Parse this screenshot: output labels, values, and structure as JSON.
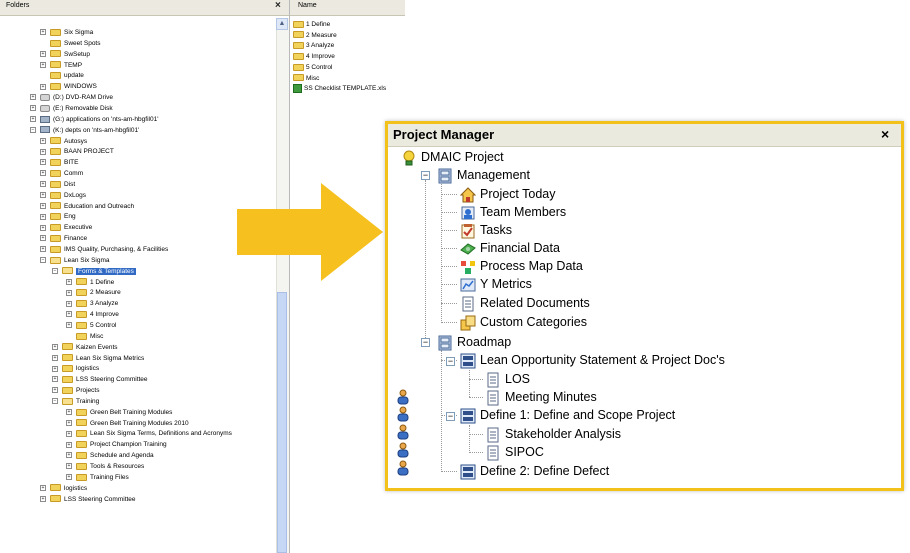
{
  "explorer": {
    "folders_title": "Folders",
    "close_glyph": "×",
    "name_column": "Name",
    "tree": [
      {
        "label": "Six Sigma",
        "level": 2,
        "exp": "+",
        "icon": "folder"
      },
      {
        "label": "Sweet Spots",
        "level": 2,
        "exp": "",
        "icon": "folder"
      },
      {
        "label": "SwSetup",
        "level": 2,
        "exp": "+",
        "icon": "folder"
      },
      {
        "label": "TEMP",
        "level": 2,
        "exp": "+",
        "icon": "folder"
      },
      {
        "label": "update",
        "level": 2,
        "exp": "",
        "icon": "folder"
      },
      {
        "label": "WINDOWS",
        "level": 2,
        "exp": "+",
        "icon": "folder"
      },
      {
        "label": "(D:) DVD-RAM Drive",
        "level": 1,
        "exp": "+",
        "icon": "drive"
      },
      {
        "label": "(E:) Removable Disk",
        "level": 1,
        "exp": "+",
        "icon": "drive"
      },
      {
        "label": "(G:) applications on 'nts-am-hbgfil01'",
        "level": 1,
        "exp": "+",
        "icon": "net"
      },
      {
        "label": "(K:) depts on 'nts-am-hbgfil01'",
        "level": 1,
        "exp": "−",
        "icon": "net"
      },
      {
        "label": "Autosys",
        "level": 2,
        "exp": "+",
        "icon": "folder"
      },
      {
        "label": "BAAN PROJECT",
        "level": 2,
        "exp": "+",
        "icon": "folder"
      },
      {
        "label": "BITE",
        "level": 2,
        "exp": "+",
        "icon": "folder"
      },
      {
        "label": "Comm",
        "level": 2,
        "exp": "+",
        "icon": "folder"
      },
      {
        "label": "Dist",
        "level": 2,
        "exp": "+",
        "icon": "folder"
      },
      {
        "label": "DxLogs",
        "level": 2,
        "exp": "+",
        "icon": "folder"
      },
      {
        "label": "Education and Outreach",
        "level": 2,
        "exp": "+",
        "icon": "folder"
      },
      {
        "label": "Eng",
        "level": 2,
        "exp": "+",
        "icon": "folder"
      },
      {
        "label": "Executive",
        "level": 2,
        "exp": "+",
        "icon": "folder"
      },
      {
        "label": "Finance",
        "level": 2,
        "exp": "+",
        "icon": "folder"
      },
      {
        "label": "IMS Quality, Purchasing, & Facilities",
        "level": 2,
        "exp": "+",
        "icon": "folder"
      },
      {
        "label": "Lean Six Sigma",
        "level": 2,
        "exp": "−",
        "icon": "folder-open"
      },
      {
        "label": "Forms & Templates",
        "level": 3,
        "exp": "−",
        "icon": "folder-open",
        "selected": true
      },
      {
        "label": "1 Define",
        "level": 4,
        "exp": "+",
        "icon": "folder"
      },
      {
        "label": "2 Measure",
        "level": 4,
        "exp": "+",
        "icon": "folder"
      },
      {
        "label": "3 Analyze",
        "level": 4,
        "exp": "+",
        "icon": "folder"
      },
      {
        "label": "4 Improve",
        "level": 4,
        "exp": "+",
        "icon": "folder"
      },
      {
        "label": "5 Control",
        "level": 4,
        "exp": "+",
        "icon": "folder"
      },
      {
        "label": "Misc",
        "level": 4,
        "exp": "",
        "icon": "folder"
      },
      {
        "label": "Kaizen Events",
        "level": 3,
        "exp": "+",
        "icon": "folder"
      },
      {
        "label": "Lean Six Sigma Metrics",
        "level": 3,
        "exp": "+",
        "icon": "folder"
      },
      {
        "label": "logistics",
        "level": 3,
        "exp": "+",
        "icon": "folder"
      },
      {
        "label": "LSS Steering Committee",
        "level": 3,
        "exp": "+",
        "icon": "folder"
      },
      {
        "label": "Projects",
        "level": 3,
        "exp": "+",
        "icon": "folder"
      },
      {
        "label": "Training",
        "level": 3,
        "exp": "−",
        "icon": "folder-open"
      },
      {
        "label": "Green Belt Training Modules",
        "level": 4,
        "exp": "+",
        "icon": "folder"
      },
      {
        "label": "Green Belt Training Modules 2010",
        "level": 4,
        "exp": "+",
        "icon": "folder"
      },
      {
        "label": "Lean Six Sigma Terms, Definitions and Acronyms",
        "level": 4,
        "exp": "+",
        "icon": "folder"
      },
      {
        "label": "Project Champion Training",
        "level": 4,
        "exp": "+",
        "icon": "folder"
      },
      {
        "label": "Schedule and Agenda",
        "level": 4,
        "exp": "+",
        "icon": "folder"
      },
      {
        "label": "Tools & Resources",
        "level": 4,
        "exp": "+",
        "icon": "folder"
      },
      {
        "label": "Training Files",
        "level": 4,
        "exp": "+",
        "icon": "folder"
      },
      {
        "label": "logistics",
        "level": 2,
        "exp": "+",
        "icon": "folder"
      },
      {
        "label": "LSS Steering Committee",
        "level": 2,
        "exp": "+",
        "icon": "folder"
      }
    ],
    "files": [
      {
        "label": "1 Define",
        "icon": "folder"
      },
      {
        "label": "2 Measure",
        "icon": "folder"
      },
      {
        "label": "3 Analyze",
        "icon": "folder"
      },
      {
        "label": "4 Improve",
        "icon": "folder"
      },
      {
        "label": "5 Control",
        "icon": "folder"
      },
      {
        "label": "Misc",
        "icon": "folder"
      },
      {
        "label": "SS Checklist TEMPLATE.xls",
        "icon": "excel"
      }
    ]
  },
  "project_manager": {
    "title": "Project Manager",
    "close_glyph": "×",
    "root": "DMAIC Project",
    "management": {
      "label": "Management",
      "items": [
        "Project Today",
        "Team Members",
        "Tasks",
        "Financial Data",
        "Process Map Data",
        "Y Metrics",
        "Related Documents",
        "Custom Categories"
      ]
    },
    "roadmap": {
      "label": "Roadmap",
      "lean_statement": "Lean Opportunity Statement & Project Doc's",
      "lean_children": [
        "LOS",
        "Meeting Minutes"
      ],
      "define1": "Define 1: Define and Scope Project",
      "define1_children": [
        "Stakeholder Analysis",
        "SIPOC"
      ],
      "define2": "Define 2: Define Defect"
    }
  },
  "colors": {
    "accent_border": "#f2c21a",
    "arrow": "#f6c11f",
    "selection": "#316ac5"
  }
}
